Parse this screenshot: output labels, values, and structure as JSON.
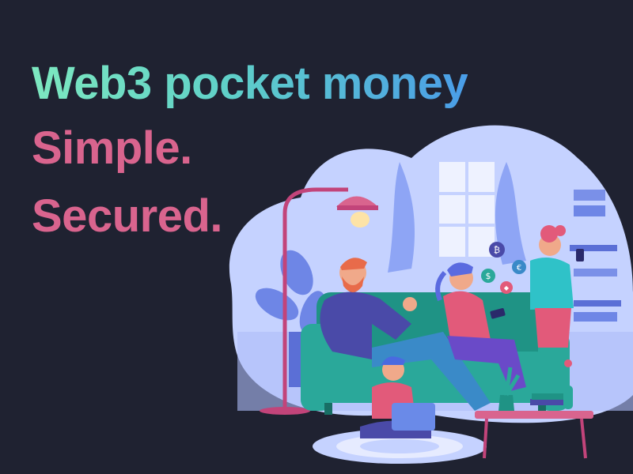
{
  "headline": "Web3 pocket money",
  "taglines": [
    "Simple.",
    "Secured."
  ],
  "colors": {
    "background": "#1f2231",
    "headline_gradient_start": "#7de8c0",
    "headline_gradient_end": "#4a9de8",
    "tagline": "#d9648e",
    "sofa": "#2aa89a",
    "room": "#c5d2ff"
  },
  "coin_icons": [
    "bitcoin-symbol",
    "dollar-symbol",
    "euro-symbol",
    "ethereum-symbol"
  ],
  "coin_glyphs": [
    "₿",
    "$",
    "€",
    "◆"
  ]
}
